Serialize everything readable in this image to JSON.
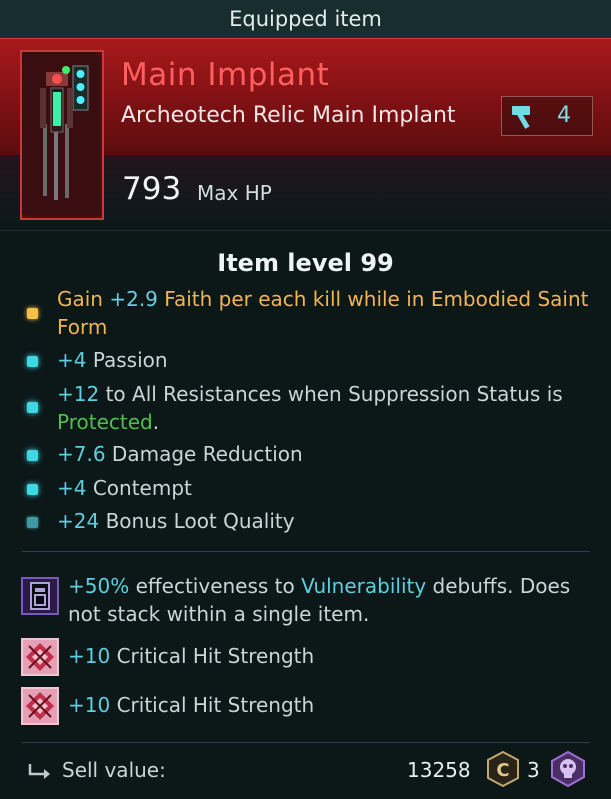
{
  "header": {
    "title": "Equipped item"
  },
  "item": {
    "name": "Main Implant",
    "type": "Archeotech Relic Main Implant",
    "tier_icon": "hammer-icon",
    "tier": "4",
    "hp_value": "793",
    "hp_label": "Max HP",
    "level": "Item level 99"
  },
  "affixes": [
    {
      "bullet": "gold",
      "prefix": "Gain ",
      "value": "+2.9",
      "text": " Faith per each kill while in Embodied Saint Form"
    },
    {
      "bullet": "cyan",
      "value": "+4",
      "text": " Passion"
    },
    {
      "bullet": "cyan",
      "value": "+12",
      "text": " to All Resistances when Suppression Status is ",
      "highlight": "Protected",
      "suffix": "."
    },
    {
      "bullet": "cyan",
      "value": "+7.6",
      "text": " Damage Reduction"
    },
    {
      "bullet": "cyan",
      "value": "+4",
      "text": " Contempt"
    },
    {
      "bullet": "dim",
      "value": "+24",
      "text": " Bonus Loot Quality"
    }
  ],
  "perks": [
    {
      "icon": "vulnerability-chip-icon",
      "value": "+50%",
      "text1": " effectiveness to ",
      "highlight": "Vulnerability",
      "text2": " debuffs. Does not stack within a single item."
    },
    {
      "icon": "critical-strike-icon",
      "value": "+10",
      "text": " Critical Hit Strength"
    },
    {
      "icon": "critical-strike-icon",
      "value": "+10",
      "text": " Critical Hit Strength"
    }
  ],
  "sell": {
    "label": "Sell value:",
    "amount": "13258",
    "currency_icon": "credits-icon",
    "count": "3",
    "skull_icon": "skull-token-icon"
  }
}
